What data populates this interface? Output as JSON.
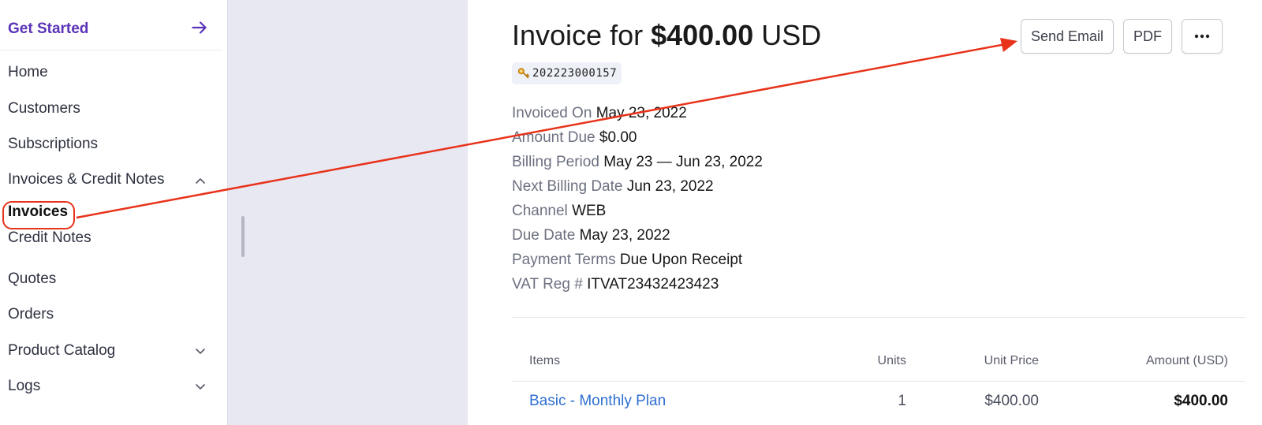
{
  "sidebar": {
    "get_started": "Get Started",
    "items": [
      {
        "label": "Home"
      },
      {
        "label": "Customers"
      },
      {
        "label": "Subscriptions"
      },
      {
        "label": "Invoices & Credit Notes"
      },
      {
        "label": "Invoices"
      },
      {
        "label": "Credit Notes"
      },
      {
        "label": "Quotes"
      },
      {
        "label": "Orders"
      },
      {
        "label": "Product Catalog"
      },
      {
        "label": "Logs"
      }
    ]
  },
  "invoice": {
    "title_prefix": "Invoice for ",
    "title_amount": "$400.00",
    "title_currency": " USD",
    "id": "202223000157",
    "details": [
      {
        "label": "Invoiced On",
        "value": "May 23, 2022"
      },
      {
        "label": "Amount Due",
        "value": "$0.00"
      },
      {
        "label": "Billing Period",
        "value": "May 23 — Jun 23, 2022"
      },
      {
        "label": "Next Billing Date",
        "value": "Jun 23, 2022"
      },
      {
        "label": "Channel",
        "value": "WEB"
      },
      {
        "label": "Due Date",
        "value": "May 23, 2022"
      },
      {
        "label": "Payment Terms",
        "value": "Due Upon Receipt"
      },
      {
        "label": "VAT Reg #",
        "value": "ITVAT23432423423"
      }
    ]
  },
  "actions": {
    "send_email": "Send Email",
    "pdf": "PDF"
  },
  "table": {
    "headers": {
      "items": "Items",
      "units": "Units",
      "unit_price": "Unit Price",
      "amount": "Amount (USD)"
    },
    "rows": [
      {
        "item": "Basic - Monthly Plan",
        "units": "1",
        "unit_price": "$400.00",
        "amount": "$400.00"
      }
    ]
  },
  "colors": {
    "accent": "#5b33b8",
    "link": "#2f6fd0",
    "annotation": "#e8321a"
  }
}
